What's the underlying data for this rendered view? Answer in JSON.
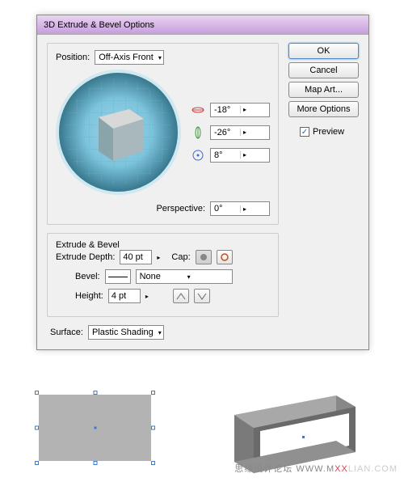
{
  "dialog": {
    "title": "3D Extrude & Bevel Options",
    "position_label": "Position:",
    "position_value": "Off-Axis Front",
    "axes": {
      "x": "-18°",
      "y": "-26°",
      "z": "8°"
    },
    "perspective_label": "Perspective:",
    "perspective_value": "0°"
  },
  "extrude": {
    "legend": "Extrude & Bevel",
    "depth_label": "Extrude Depth:",
    "depth_value": "40 pt",
    "cap_label": "Cap:",
    "bevel_label": "Bevel:",
    "bevel_value": "None",
    "height_label": "Height:",
    "height_value": "4 pt"
  },
  "surface": {
    "label": "Surface:",
    "value": "Plastic Shading"
  },
  "buttons": {
    "ok": "OK",
    "cancel": "Cancel",
    "map_art": "Map Art...",
    "more_options": "More Options",
    "preview": "Preview"
  },
  "watermark": {
    "text": "思缘设计论坛  WWW.M",
    "x": "XX",
    "tail": "LIAN.COM"
  }
}
